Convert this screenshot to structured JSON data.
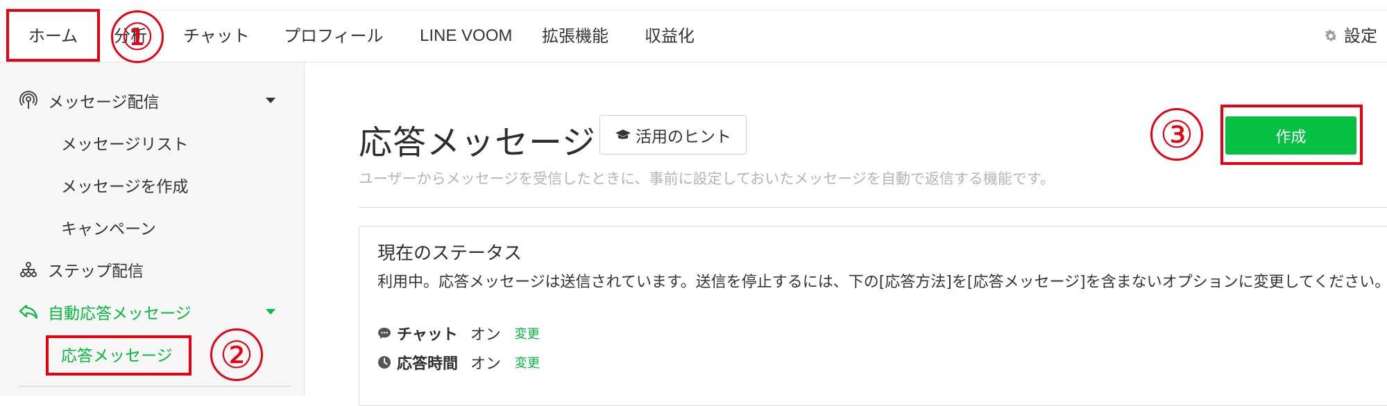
{
  "topnav": {
    "items": [
      {
        "label": "ホーム"
      },
      {
        "label": "分析"
      },
      {
        "label": "チャット"
      },
      {
        "label": "プロフィール"
      },
      {
        "label": "LINE VOOM"
      },
      {
        "label": "拡張機能"
      },
      {
        "label": "収益化"
      }
    ],
    "settings_label": "設定",
    "settings_icon": "gear-icon"
  },
  "sidebar": {
    "items": [
      {
        "label": "メッセージ配信",
        "icon": "broadcast-icon",
        "expanded": true
      },
      {
        "label": "メッセージリスト"
      },
      {
        "label": "メッセージを作成"
      },
      {
        "label": "キャンペーン"
      },
      {
        "label": "ステップ配信",
        "icon": "step-tree-icon"
      },
      {
        "label": "自動応答メッセージ",
        "icon": "reply-arrow-icon",
        "expanded": true,
        "active": true
      },
      {
        "label": "応答メッセージ",
        "active": true
      }
    ],
    "accent_color": "#06b83b"
  },
  "main": {
    "title": "応答メッセージ",
    "hint_button": "活用のヒント",
    "hint_icon": "graduation-cap-icon",
    "subtitle": "ユーザーからメッセージを受信したときに、事前に設定しておいたメッセージを自動で返信する機能です。",
    "create_button": "作成",
    "create_color": "#06c043",
    "status": {
      "title": "現在のステータス",
      "text": "利用中。応答メッセージは送信されています。送信を停止するには、下の[応答方法]を[応答メッセージ]を含まないオプションに変更してください。",
      "rows": [
        {
          "icon": "chat-bubble-icon",
          "label": "チャット",
          "value": "オン",
          "change": "変更"
        },
        {
          "icon": "clock-icon",
          "label": "応答時間",
          "value": "オン",
          "change": "変更"
        }
      ]
    }
  },
  "annotations": {
    "step1": "①",
    "step2": "②",
    "step3": "③",
    "color": "#e60012"
  }
}
